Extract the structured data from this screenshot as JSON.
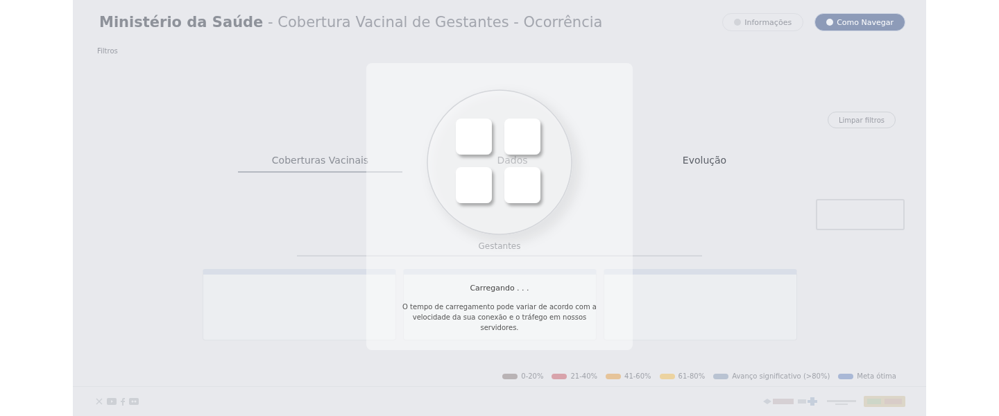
{
  "header": {
    "title": "**Ministério da Saúde** - Cobertura Vacinal de Gestantes - Ocorrência",
    "buttons": [
      {
        "label": "Informações",
        "kind": "outline"
      },
      {
        "label": "Como Navegar",
        "kind": "filled"
      }
    ]
  },
  "filters": {
    "label": "Filtros",
    "clear_button": "Limpar filtros"
  },
  "tabs": [
    {
      "label": "Coberturas Vacinais",
      "selected": true
    },
    {
      "label": "Dados",
      "selected": false
    },
    {
      "label": "Evolução",
      "selected": false
    }
  ],
  "section": {
    "title": "Gestantes"
  },
  "legend": [
    {
      "label": "0-20%",
      "color": "#b9b3b5"
    },
    {
      "label": "21-40%",
      "color": "#d8a3ab"
    },
    {
      "label": "41-60%",
      "color": "#e6c49a"
    },
    {
      "label": "61-80%",
      "color": "#ecd3a0"
    },
    {
      "label": "Avanço significativo (>80%)",
      "color": "#b9c3d2"
    },
    {
      "label": "Meta ótima",
      "color": "#a9b8d6"
    }
  ],
  "loading": {
    "title": "Carregando . . .",
    "message": "O tempo de carregamento pode variar de acordo com a velocidade da sua conexão e o tráfego em nossos servidores."
  }
}
